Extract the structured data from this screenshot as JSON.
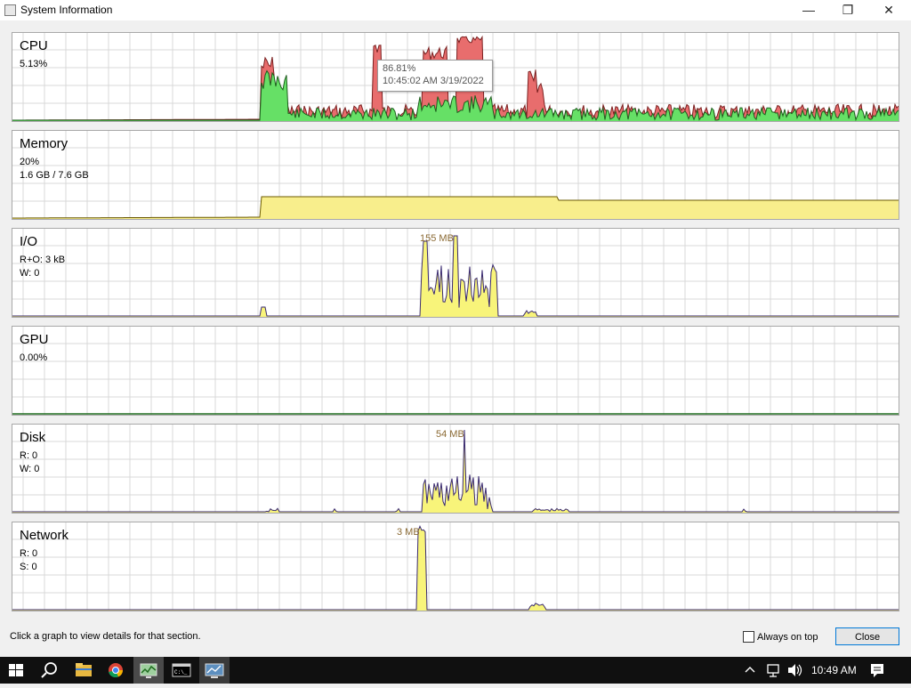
{
  "window": {
    "title": "System Information",
    "minimize": "—",
    "maximize": "❐",
    "close": "✕"
  },
  "panels": [
    {
      "id": "cpu",
      "title": "CPU",
      "line1": "5.13%",
      "line2": "",
      "peak": ""
    },
    {
      "id": "memory",
      "title": "Memory",
      "line1": "20%",
      "line2": "1.6 GB / 7.6 GB",
      "peak": ""
    },
    {
      "id": "io",
      "title": "I/O",
      "line1": "R+O: 3 kB",
      "line2": "W: 0",
      "peak": "155 MB"
    },
    {
      "id": "gpu",
      "title": "GPU",
      "line1": "0.00%",
      "line2": "",
      "peak": ""
    },
    {
      "id": "disk",
      "title": "Disk",
      "line1": "R: 0",
      "line2": "W: 0",
      "peak": "54 MB"
    },
    {
      "id": "network",
      "title": "Network",
      "line1": "R: 0",
      "line2": "S: 0",
      "peak": "3 MB"
    }
  ],
  "tooltip": {
    "value": "86.81%",
    "time": "10:45:02 AM 3/19/2022"
  },
  "footer": {
    "hint": "Click a graph to view details for that section.",
    "always_on_top_label": "Always on top",
    "always_on_top_checked": false,
    "close_label": "Close"
  },
  "taskbar": {
    "clock": "10:49 AM",
    "icons": [
      "windows-start-icon",
      "search-icon",
      "file-explorer-icon",
      "chrome-icon",
      "system-information-icon",
      "command-prompt-icon",
      "remote-desktop-icon"
    ]
  },
  "colors": {
    "cpu_total": "#e86d6d",
    "cpu_user": "#66e066",
    "memory_fill": "#f8ee8c",
    "io_fill": "#f8f47a",
    "grid": "#d9d9d9",
    "accent": "#0078d7"
  }
}
